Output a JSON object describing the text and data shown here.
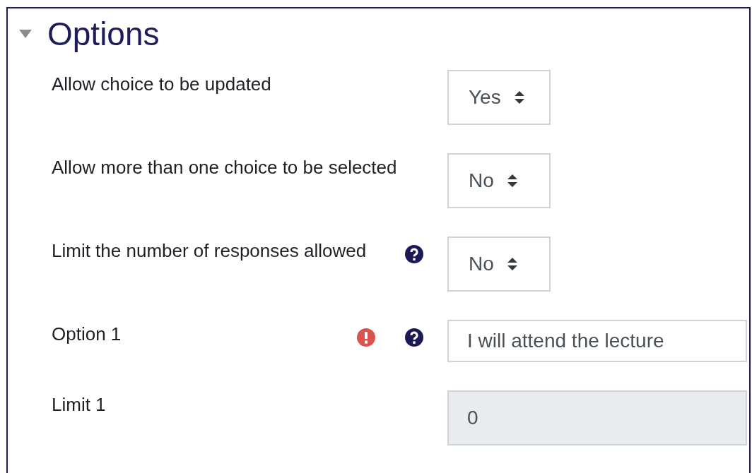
{
  "section": {
    "title": "Options",
    "expanded": true
  },
  "fields": [
    {
      "label": "Allow choice to be updated",
      "kind": "select",
      "value": "Yes",
      "error": false,
      "help": false,
      "disabled": false
    },
    {
      "label": "Allow more than one choice to be selected",
      "kind": "select",
      "value": "No",
      "error": false,
      "help": false,
      "disabled": false
    },
    {
      "label": "Limit the number of responses allowed",
      "kind": "select",
      "value": "No",
      "error": false,
      "help": true,
      "disabled": false
    },
    {
      "label": "Option 1",
      "kind": "text",
      "value": "I will attend the lecture",
      "error": true,
      "help": true,
      "disabled": false
    },
    {
      "label": "Limit 1",
      "kind": "text",
      "value": "0",
      "error": false,
      "help": false,
      "disabled": true
    }
  ]
}
